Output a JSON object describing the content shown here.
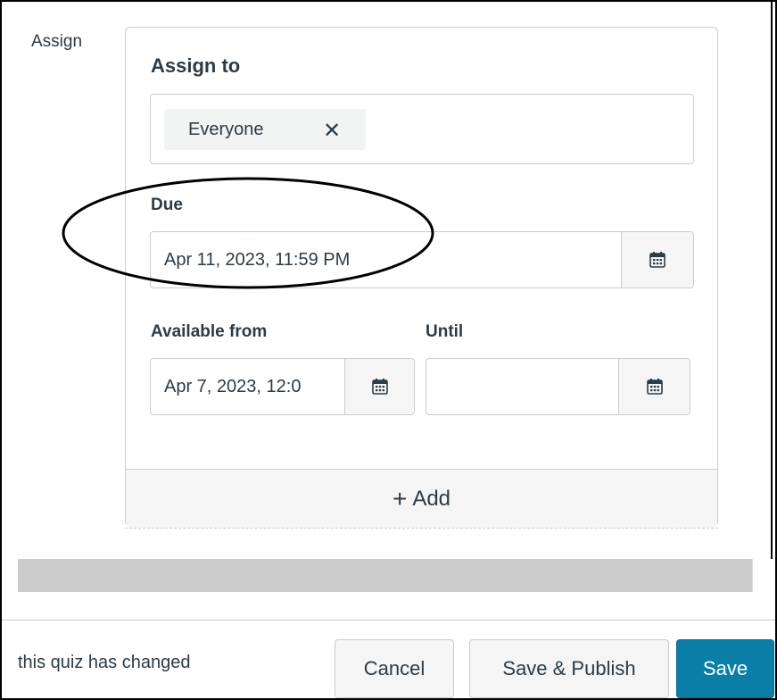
{
  "section_label": "Assign",
  "assign_card": {
    "assign_to_heading": "Assign to",
    "assignee_tag": "Everyone",
    "due_label": "Due",
    "due_value": "Apr 11, 2023, 11:59 PM",
    "available_from_label": "Available from",
    "available_from_value": "Apr 7, 2023, 12:0",
    "until_label": "Until",
    "until_value": "",
    "add_label": "Add"
  },
  "footer": {
    "note": "this quiz has changed",
    "cancel_label": "Cancel",
    "save_publish_label": "Save & Publish",
    "save_label": "Save"
  },
  "colors": {
    "primary_button": "#0b7ea8",
    "border": "#c7cdd1",
    "text": "#2d3b45"
  },
  "icons": {
    "remove_tag": "close-icon",
    "date_picker": "calendar-icon",
    "add": "plus-icon"
  }
}
